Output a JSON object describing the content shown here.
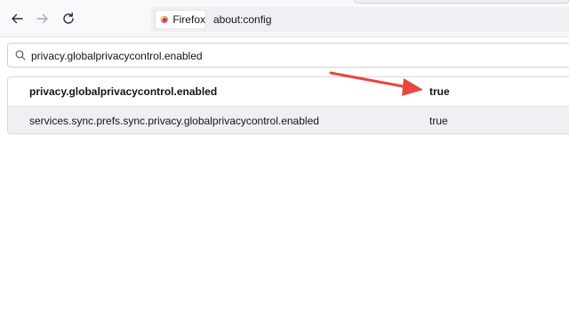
{
  "toolbar": {
    "back_icon": "back-arrow-icon",
    "forward_icon": "forward-arrow-icon",
    "reload_icon": "reload-icon"
  },
  "urlbar": {
    "identity_label": "Firefox",
    "url": "about:config"
  },
  "search": {
    "value": "privacy.globalprivacycontrol.enabled"
  },
  "prefs": [
    {
      "name": "privacy.globalprivacycontrol.enabled",
      "value": "true",
      "modified": true
    },
    {
      "name": "services.sync.prefs.sync.privacy.globalprivacycontrol.enabled",
      "value": "true",
      "modified": false
    }
  ],
  "annotation": {
    "color": "#e8473b"
  }
}
